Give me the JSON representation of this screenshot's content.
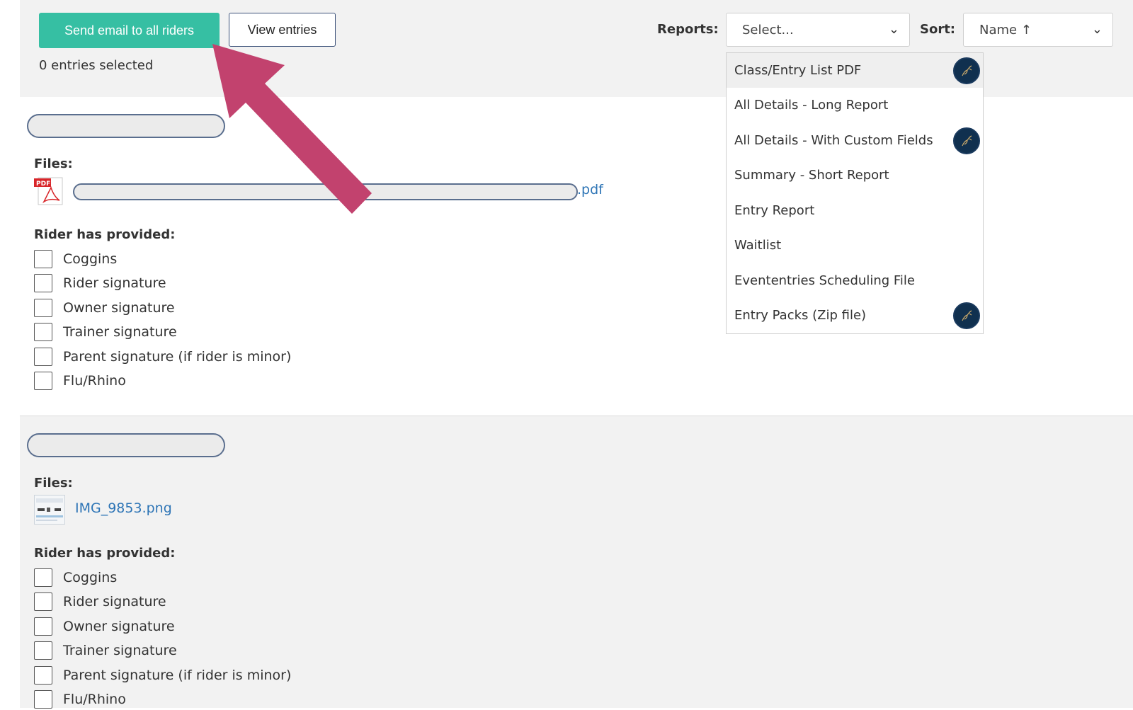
{
  "toolbar": {
    "send_email_label": "Send email to all riders",
    "view_entries_label": "View entries",
    "entries_selected": "0 entries selected",
    "reports_label": "Reports:",
    "reports_value": "Select...",
    "sort_label": "Sort:",
    "sort_value": "Name ↑"
  },
  "reports_dropdown": {
    "items": [
      {
        "label": "Class/Entry List PDF",
        "badge": true,
        "highlighted": true
      },
      {
        "label": "All Details - Long Report",
        "badge": false
      },
      {
        "label": "All Details - With Custom Fields",
        "badge": true
      },
      {
        "label": "Summary - Short Report",
        "badge": false
      },
      {
        "label": "Entry Report",
        "badge": false
      },
      {
        "label": "Waitlist",
        "badge": false
      },
      {
        "label": "Evententries Scheduling File",
        "badge": false
      },
      {
        "label": "Entry Packs (Zip file)",
        "badge": true
      }
    ]
  },
  "entries": [
    {
      "files_label": "Files:",
      "file_name": ".pdf",
      "file_icon": "pdf-icon",
      "provided_label": "Rider has provided:",
      "checklist": [
        "Coggins",
        "Rider signature",
        "Owner signature",
        "Trainer signature",
        "Parent signature (if rider is minor)",
        "Flu/Rhino"
      ]
    },
    {
      "files_label": "Files:",
      "file_name": "IMG_9853.png",
      "file_icon": "image-thumbnail-icon",
      "provided_label": "Rider has provided:",
      "checklist": [
        "Coggins",
        "Rider signature",
        "Owner signature",
        "Trainer signature",
        "Parent signature (if rider is minor)",
        "Flu/Rhino"
      ]
    }
  ],
  "colors": {
    "primary_button": "#36bfa3",
    "link": "#2e75b6",
    "annotation_arrow": "#c2426e",
    "badge": "#10304f"
  }
}
